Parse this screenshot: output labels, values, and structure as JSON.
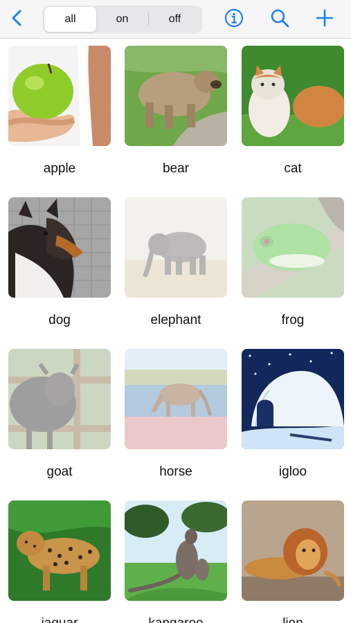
{
  "toolbar": {
    "back_icon": "chevron-left-icon",
    "segments": [
      {
        "label": "all",
        "active": true
      },
      {
        "label": "on",
        "active": false
      },
      {
        "label": "off",
        "active": false
      }
    ],
    "info_icon": "info-icon",
    "search_icon": "search-icon",
    "add_icon": "plus-icon",
    "accent_color": "#1a7ff2"
  },
  "items": [
    {
      "label": "apple",
      "state": "on"
    },
    {
      "label": "bear",
      "state": "on"
    },
    {
      "label": "cat",
      "state": "on"
    },
    {
      "label": "dog",
      "state": "on"
    },
    {
      "label": "elephant",
      "state": "off"
    },
    {
      "label": "frog",
      "state": "off"
    },
    {
      "label": "goat",
      "state": "off"
    },
    {
      "label": "horse",
      "state": "off"
    },
    {
      "label": "igloo",
      "state": "on"
    },
    {
      "label": "jaguar",
      "state": "on"
    },
    {
      "label": "kangaroo",
      "state": "on"
    },
    {
      "label": "lion",
      "state": "on"
    }
  ]
}
